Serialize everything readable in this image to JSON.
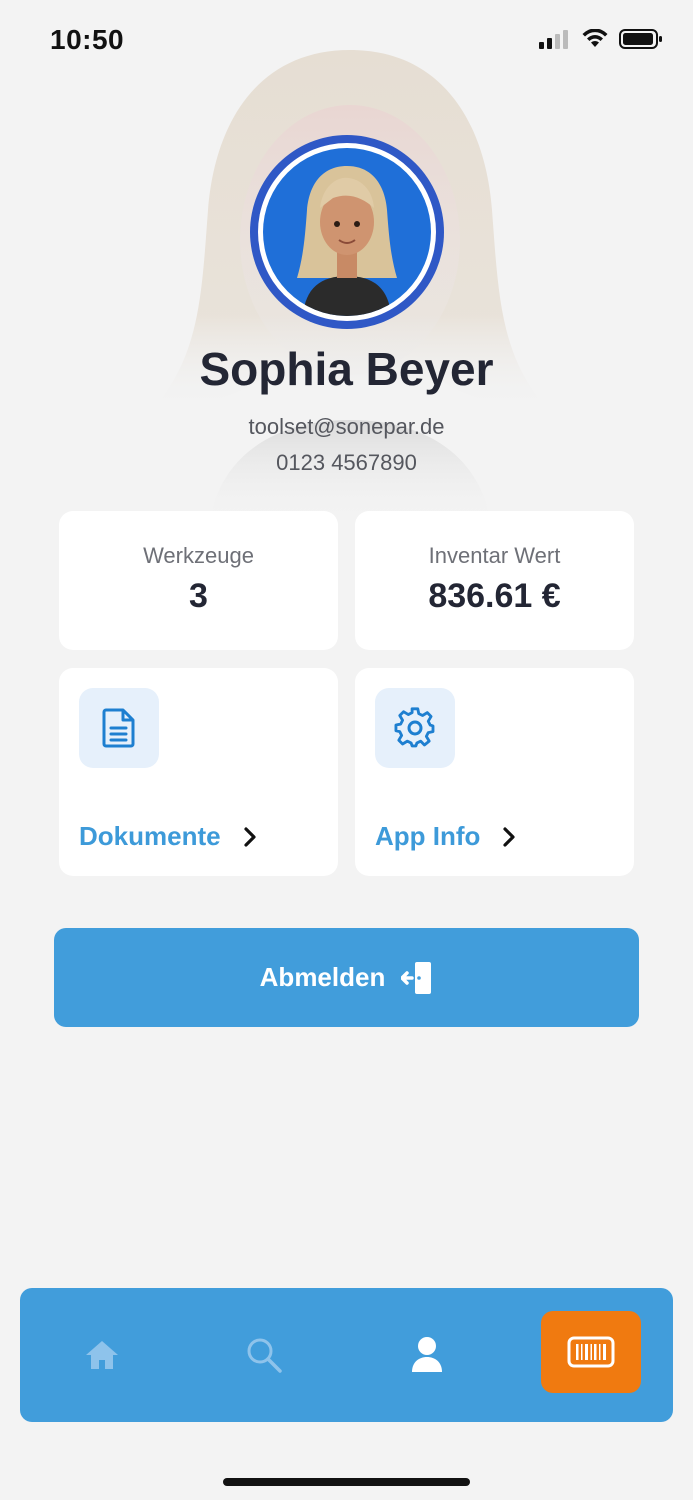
{
  "status_bar": {
    "time": "10:50"
  },
  "profile": {
    "name": "Sophia Beyer",
    "email": "toolset@sonepar.de",
    "phone": "0123 4567890"
  },
  "stats": [
    {
      "label": "Werkzeuge",
      "value": "3"
    },
    {
      "label": "Inventar Wert",
      "value": "836.61 €"
    }
  ],
  "tiles": [
    {
      "label": "Dokumente",
      "icon": "document-icon"
    },
    {
      "label": "App Info",
      "icon": "gear-icon"
    }
  ],
  "logout": {
    "label": "Abmelden",
    "icon": "logout-icon"
  },
  "tabbar": {
    "items": [
      {
        "icon": "home-icon",
        "active": false
      },
      {
        "icon": "search-icon",
        "active": false
      },
      {
        "icon": "user-icon",
        "active": true
      },
      {
        "icon": "barcode-scan-icon",
        "active": false
      }
    ]
  },
  "colors": {
    "accent": "#419ddb",
    "scan_button": "#f07a10",
    "background": "#f3f3f3",
    "text_dark": "#232634"
  }
}
